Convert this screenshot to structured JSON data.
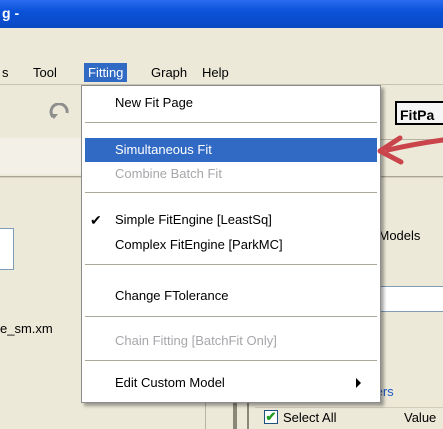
{
  "window": {
    "title": "g -"
  },
  "menubar": {
    "items": [
      {
        "label": "s"
      },
      {
        "label": "Tool"
      },
      {
        "label": "Fitting",
        "active": true
      },
      {
        "label": "Graph"
      },
      {
        "label": "Help"
      }
    ]
  },
  "toolbar": {
    "fit_page_label": "FitPa"
  },
  "fitting_menu": {
    "items": [
      {
        "label": "New Fit Page",
        "enabled": true
      },
      {
        "label": "Simultaneous Fit",
        "enabled": true,
        "highlighted": true
      },
      {
        "label": "Combine Batch Fit",
        "enabled": false
      },
      {
        "label": "Simple FitEngine [LeastSq]",
        "enabled": true,
        "checked": true
      },
      {
        "label": "Complex FitEngine [ParkMC]",
        "enabled": true
      },
      {
        "label": "Change FTolerance",
        "enabled": true
      },
      {
        "label": "Chain Fitting [BatchFit Only]",
        "enabled": false
      },
      {
        "label": "Edit Custom Model",
        "enabled": true,
        "submenu": true
      }
    ]
  },
  "left_panel": {
    "file_name": "e_sm.xm"
  },
  "right_panel": {
    "models_label": "l Models",
    "parameters_label": "ters",
    "select_all_label": "Select All",
    "value_header": "Value"
  },
  "colors": {
    "highlight": "#316ac5",
    "annotation_arrow": "#c9454b",
    "titlebar": "#0a52d8"
  },
  "icons": {
    "undo": "undo-icon",
    "checkmark": "check-icon",
    "submenu": "submenu-arrow-icon"
  }
}
